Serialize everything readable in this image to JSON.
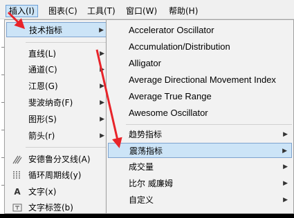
{
  "menubar": {
    "items": [
      {
        "label": "插入(I)",
        "active": true
      },
      {
        "label": "图表(C)"
      },
      {
        "label": "工具(T)"
      },
      {
        "label": "窗口(W)"
      },
      {
        "label": "帮助(H)"
      }
    ]
  },
  "insert_menu": {
    "items": [
      {
        "label": "技术指标",
        "highlighted": true,
        "submenu": true
      },
      {
        "label": "直线(L)",
        "submenu": true
      },
      {
        "label": "通道(C)",
        "submenu": true
      },
      {
        "label": "江恩(G)",
        "submenu": true
      },
      {
        "label": "斐波纳奇(F)",
        "submenu": true
      },
      {
        "label": "图形(S)",
        "submenu": true
      },
      {
        "label": "箭头(r)",
        "submenu": true
      },
      {
        "label": "安德鲁分叉线(A)",
        "icon": "pitchfork-icon"
      },
      {
        "label": "循环周期线(y)",
        "icon": "cycle-lines-icon"
      },
      {
        "label": "文字(x)",
        "icon": "text-icon"
      },
      {
        "label": "文字标签(b)",
        "icon": "text-label-icon"
      }
    ]
  },
  "indicators_submenu": {
    "items": [
      {
        "label": "Accelerator Oscillator"
      },
      {
        "label": "Accumulation/Distribution"
      },
      {
        "label": "Alligator"
      },
      {
        "label": "Average Directional Movement Index"
      },
      {
        "label": "Average True Range"
      },
      {
        "label": "Awesome Oscillator"
      },
      {
        "label": "趋势指标",
        "submenu": true
      },
      {
        "label": "震荡指标",
        "submenu": true,
        "highlighted": true
      },
      {
        "label": "成交量",
        "submenu": true
      },
      {
        "label": "比尔 威廉姆",
        "submenu": true
      },
      {
        "label": "自定义",
        "submenu": true
      }
    ]
  },
  "colors": {
    "highlight": "#cce4f7",
    "annotation": "#e8242a",
    "menu_bg": "#f2f2f2"
  }
}
